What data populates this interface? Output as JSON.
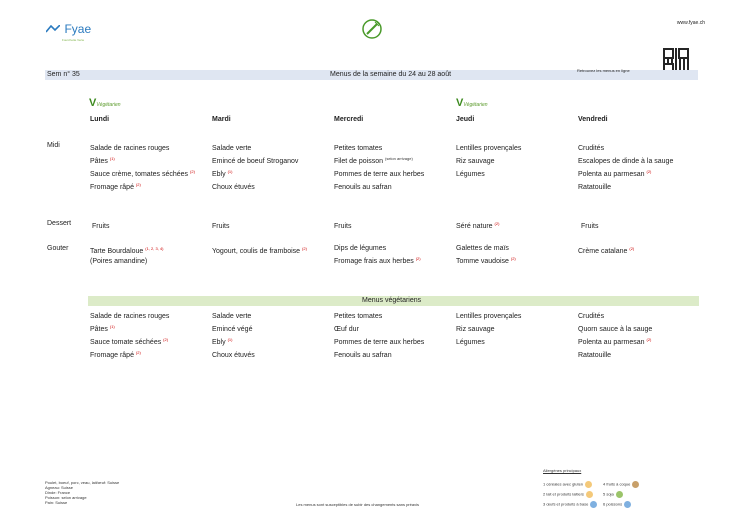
{
  "header": {
    "brand": "Fyae",
    "tagline": "Fourchette Verte",
    "website": "www.fyae.ch",
    "qr_caption": "Retrouvez les menus en ligne"
  },
  "bar": {
    "week": "Sem n° 35",
    "title": "Menus de la semaine du 24 au 28 août"
  },
  "vegetarian_label": "Végétarien",
  "days": [
    "Lundi",
    "Mardi",
    "Mercredi",
    "Jeudi",
    "Vendredi"
  ],
  "row_labels": {
    "midi": "Midi",
    "dessert": "Dessert",
    "gouter": "Gouter"
  },
  "midi": [
    [
      {
        "t": "Salade de racines rouges",
        "s": ""
      },
      {
        "t": "Pâtes",
        "s": "(1)"
      },
      {
        "t": "Sauce crème, tomates séchées",
        "s": "(2)"
      },
      {
        "t": "Fromage râpé",
        "s": "(2)"
      }
    ],
    [
      {
        "t": "Salade verte",
        "s": ""
      },
      {
        "t": "Emincé de boeuf Stroganov",
        "s": ""
      },
      {
        "t": "Ebly",
        "s": "(1)"
      },
      {
        "t": "Choux étuvés",
        "s": ""
      }
    ],
    [
      {
        "t": "Petites tomates",
        "s": ""
      },
      {
        "t": "Filet de poisson",
        "s": "(selon arrivage)"
      },
      {
        "t": "Pommes de terre aux herbes",
        "s": ""
      },
      {
        "t": "Fenouils au safran",
        "s": ""
      }
    ],
    [
      {
        "t": "Lentilles provençales",
        "s": ""
      },
      {
        "t": "Riz sauvage",
        "s": ""
      },
      {
        "t": "Légumes",
        "s": ""
      }
    ],
    [
      {
        "t": "Crudités",
        "s": ""
      },
      {
        "t": "Escalopes de dinde à la sauge",
        "s": ""
      },
      {
        "t": "Polenta au parmesan",
        "s": "(2)"
      },
      {
        "t": "Ratatouille",
        "s": ""
      }
    ]
  ],
  "dessert": [
    {
      "t": "Fruits",
      "s": ""
    },
    {
      "t": "Fruits",
      "s": ""
    },
    {
      "t": "Fruits",
      "s": ""
    },
    {
      "t": "Séré nature",
      "s": "(2)"
    },
    {
      "t": "Fruits",
      "s": ""
    }
  ],
  "gouter": [
    [
      {
        "t": "Tarte Bourdaloue",
        "s": "(1, 2, 3, 4)"
      },
      {
        "t": "(Poires amandine)",
        "s": ""
      }
    ],
    [
      {
        "t": "Yogourt, coulis de framboise",
        "s": "(2)"
      }
    ],
    [
      {
        "t": "Dips de légumes",
        "s": ""
      },
      {
        "t": "Fromage frais aux herbes",
        "s": "(2)"
      }
    ],
    [
      {
        "t": "Galettes de maïs",
        "s": ""
      },
      {
        "t": "Tomme vaudoise",
        "s": "(2)"
      }
    ],
    [
      {
        "t": "Crème catalane",
        "s": "(2)"
      }
    ]
  ],
  "veg_bar_title": "Menus végétariens",
  "veg": [
    [
      {
        "t": "Salade de racines rouges",
        "s": ""
      },
      {
        "t": "Pâtes",
        "s": "(1)"
      },
      {
        "t": "Sauce tomate séchées",
        "s": "(2)"
      },
      {
        "t": "Fromage râpé",
        "s": "(2)"
      }
    ],
    [
      {
        "t": "Salade verte",
        "s": ""
      },
      {
        "t": "Emincé végé",
        "s": ""
      },
      {
        "t": "Ebly",
        "s": "(1)"
      },
      {
        "t": "Choux étuvés",
        "s": ""
      }
    ],
    [
      {
        "t": "Petites tomates",
        "s": ""
      },
      {
        "t": "Œuf dur",
        "s": ""
      },
      {
        "t": "Pommes de terre aux herbes",
        "s": ""
      },
      {
        "t": "Fenouils au safran",
        "s": ""
      }
    ],
    [
      {
        "t": "Lentilles provençales",
        "s": ""
      },
      {
        "t": "Riz sauvage",
        "s": ""
      },
      {
        "t": "Légumes",
        "s": ""
      }
    ],
    [
      {
        "t": "Crudités",
        "s": ""
      },
      {
        "t": "Quorn sauce à la sauge",
        "s": ""
      },
      {
        "t": "Polenta au parmesan",
        "s": "(2)"
      },
      {
        "t": "Ratatouille",
        "s": ""
      }
    ]
  ],
  "origins": [
    "Poulet, boeuf, porc, veau, lait/œuf: Suisse",
    "Agneau: Suisse",
    "Dinde: France",
    "Poisson: selon arrivage",
    "Pain: Suisse"
  ],
  "footer_note": "Les menus sont susceptibles de subir des changements sans préavis",
  "allergens": {
    "title": "Allergènes principaux",
    "items": [
      {
        "label": "1 céréales avec gluten",
        "color": "#f4c97a"
      },
      {
        "label": "2 lait et produits laitiers",
        "color": "#f4c97a"
      },
      {
        "label": "3 œufs et produits à base",
        "color": "#7fb0e0"
      },
      {
        "label": "4 fruits à coque",
        "color": "#c8a06a"
      },
      {
        "label": "5 soja",
        "color": "#9bc46a"
      },
      {
        "label": "6 poissons",
        "color": "#7fb0e0"
      }
    ]
  }
}
